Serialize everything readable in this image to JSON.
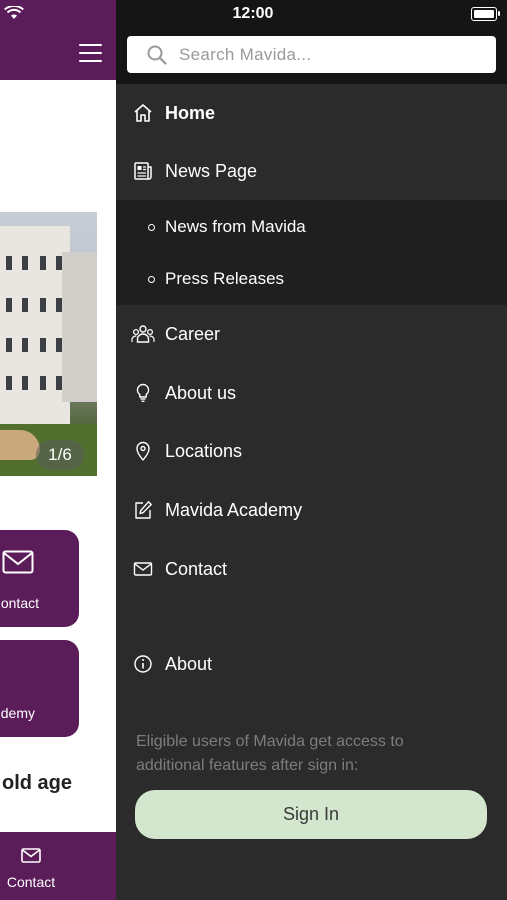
{
  "status_bar": {
    "time": "12:00"
  },
  "background_app": {
    "slideshow": {
      "counter": "1/6"
    },
    "tiles": [
      {
        "label": "Contact",
        "icon": "mail-icon"
      },
      {
        "label": "Mavida Academy",
        "icon": "academy-icon"
      }
    ],
    "section_heading": "old age",
    "tab_bar": {
      "contact_label": "Contact"
    }
  },
  "drawer": {
    "search": {
      "placeholder": "Search Mavida...",
      "value": ""
    },
    "menu": [
      {
        "id": "home",
        "label": "Home",
        "icon": "home-icon",
        "active": true
      },
      {
        "id": "news-page",
        "label": "News Page",
        "icon": "newspaper-icon",
        "expanded": true,
        "children": [
          {
            "label": "News from Mavida"
          },
          {
            "label": "Press Releases"
          }
        ]
      },
      {
        "id": "career",
        "label": "Career",
        "icon": "people-icon"
      },
      {
        "id": "about-us",
        "label": "About us",
        "icon": "lightbulb-icon"
      },
      {
        "id": "locations",
        "label": "Locations",
        "icon": "location-pin-icon"
      },
      {
        "id": "mavida-academy",
        "label": "Mavida Academy",
        "icon": "edit-icon"
      },
      {
        "id": "contact",
        "label": "Contact",
        "icon": "mail-icon"
      },
      {
        "id": "about",
        "label": "About",
        "icon": "info-icon"
      }
    ],
    "sign_in_note": "Eligible users of Mavida get access to additional features after sign in:",
    "sign_in_button": "Sign In"
  },
  "colors": {
    "brand_purple": "#5b1d5a",
    "drawer_bg": "#2b2b2b",
    "sign_in_bg": "#d3e7cf"
  }
}
